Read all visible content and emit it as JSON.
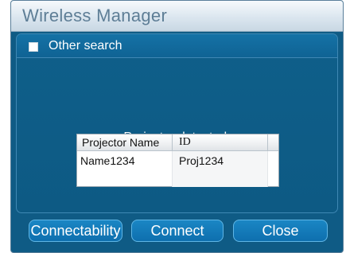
{
  "window": {
    "title": "Wireless Manager"
  },
  "option": {
    "checked": false,
    "label": "Other search"
  },
  "status": {
    "message": "Projector detected."
  },
  "table": {
    "columns": [
      "Projector Name",
      "ID",
      ""
    ],
    "rows": [
      [
        "Name1234",
        "Proj1234"
      ],
      [
        "",
        ""
      ]
    ]
  },
  "buttons": {
    "connectability": "Connectability",
    "connect": "Connect",
    "close": "Close"
  },
  "colors": {
    "window_bg": "#0f5b85",
    "button_border": "#5fb6e6",
    "title_text": "#5e7e96"
  }
}
